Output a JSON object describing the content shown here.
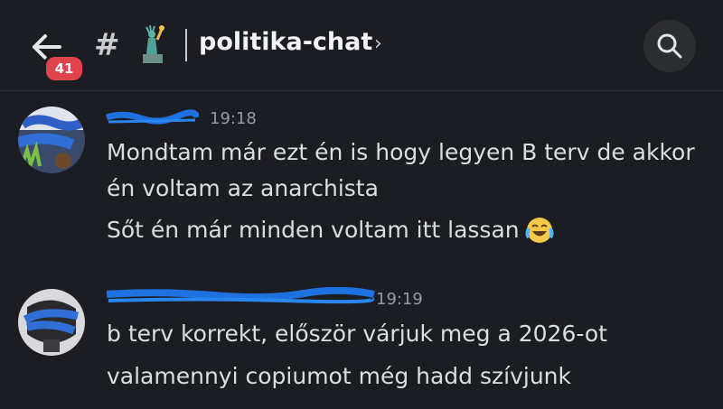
{
  "header": {
    "back_badge": "41",
    "hash": "#",
    "channel_name": "politika-chat",
    "chevron": "›",
    "icons": [
      "back-arrow-icon",
      "statue-of-liberty-icon",
      "search-icon"
    ]
  },
  "messages": [
    {
      "author": "",
      "time": "19:18",
      "lines": [
        "Mondtam már ezt én is hogy legyen B terv de akkor",
        "én voltam az anarchista",
        "Sőt én már minden voltam itt lassan"
      ],
      "emoji": "laughing-tears-emoji"
    },
    {
      "author": "",
      "time": "19:19",
      "lines": [
        "b terv korrekt, először várjuk meg a 2026-ot",
        "valamennyi copiumot még hadd szívjunk"
      ]
    }
  ],
  "colors": {
    "background": "#1c1d22",
    "username": "#00a8fc",
    "badge": "#e0434a",
    "timestamp": "#949ba4"
  }
}
